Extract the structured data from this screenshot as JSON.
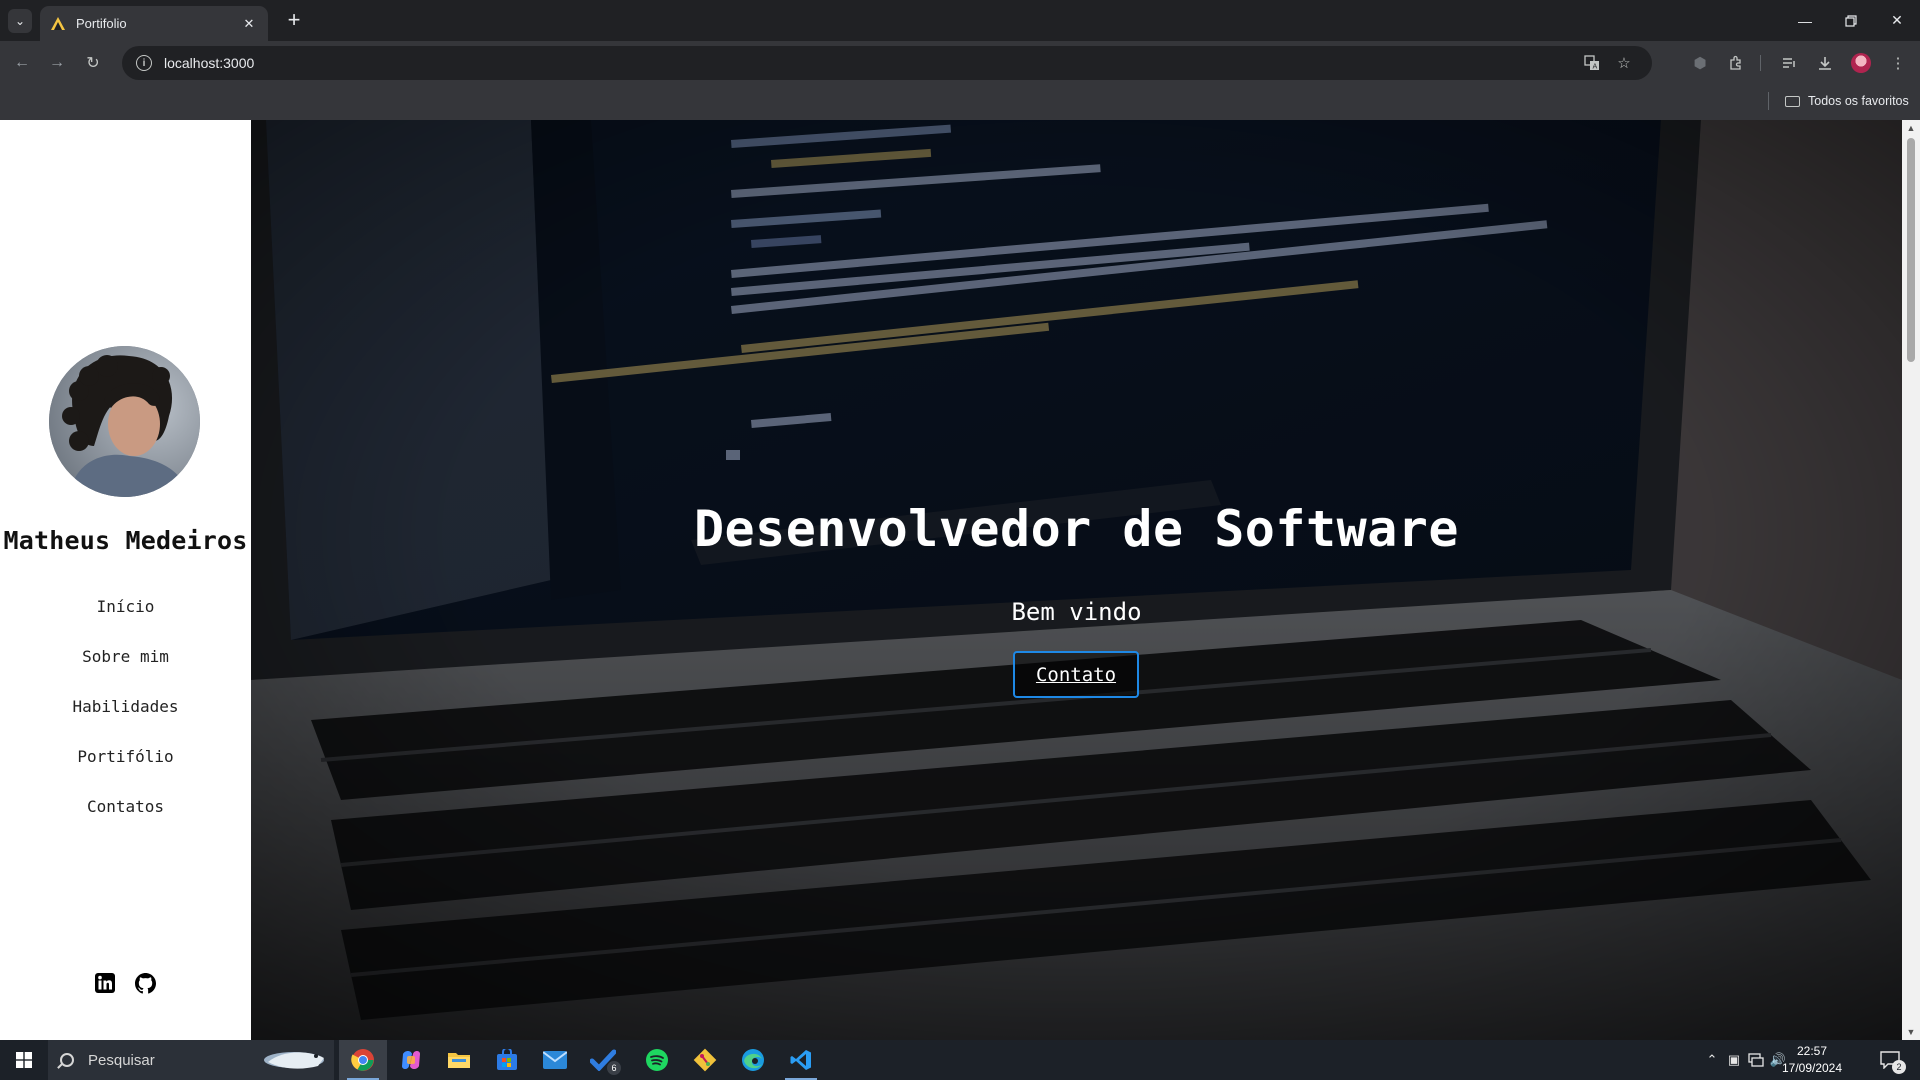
{
  "browser": {
    "tab_title": "Portifolio",
    "url": "localhost:3000",
    "bookmarks_all": "Todos os favoritos"
  },
  "sidebar": {
    "name": "Matheus Medeiros",
    "menu": [
      {
        "label": "Início"
      },
      {
        "label": "Sobre mim"
      },
      {
        "label": "Habilidades"
      },
      {
        "label": "Portifólio"
      },
      {
        "label": "Contatos"
      }
    ],
    "social_icons": [
      "linkedin-icon",
      "github-icon"
    ]
  },
  "hero": {
    "title": "Desenvolvedor de Software",
    "subtitle": "Bem vindo",
    "button": "Contato"
  },
  "taskbar": {
    "search_placeholder": "Pesquisar",
    "apps": [
      "chrome",
      "copilot",
      "file-explorer",
      "microsoft-store",
      "mail",
      "todo",
      "spotify",
      "git",
      "edge",
      "vscode"
    ],
    "todo_badge": "6",
    "time": "22:57",
    "date": "17/09/2024",
    "notification_count": "2"
  },
  "colors": {
    "accent_button_border": "#1e88e5",
    "chrome_dark": "#202124",
    "chrome_toolbar": "#35363a",
    "taskbar": "#1c2128"
  }
}
